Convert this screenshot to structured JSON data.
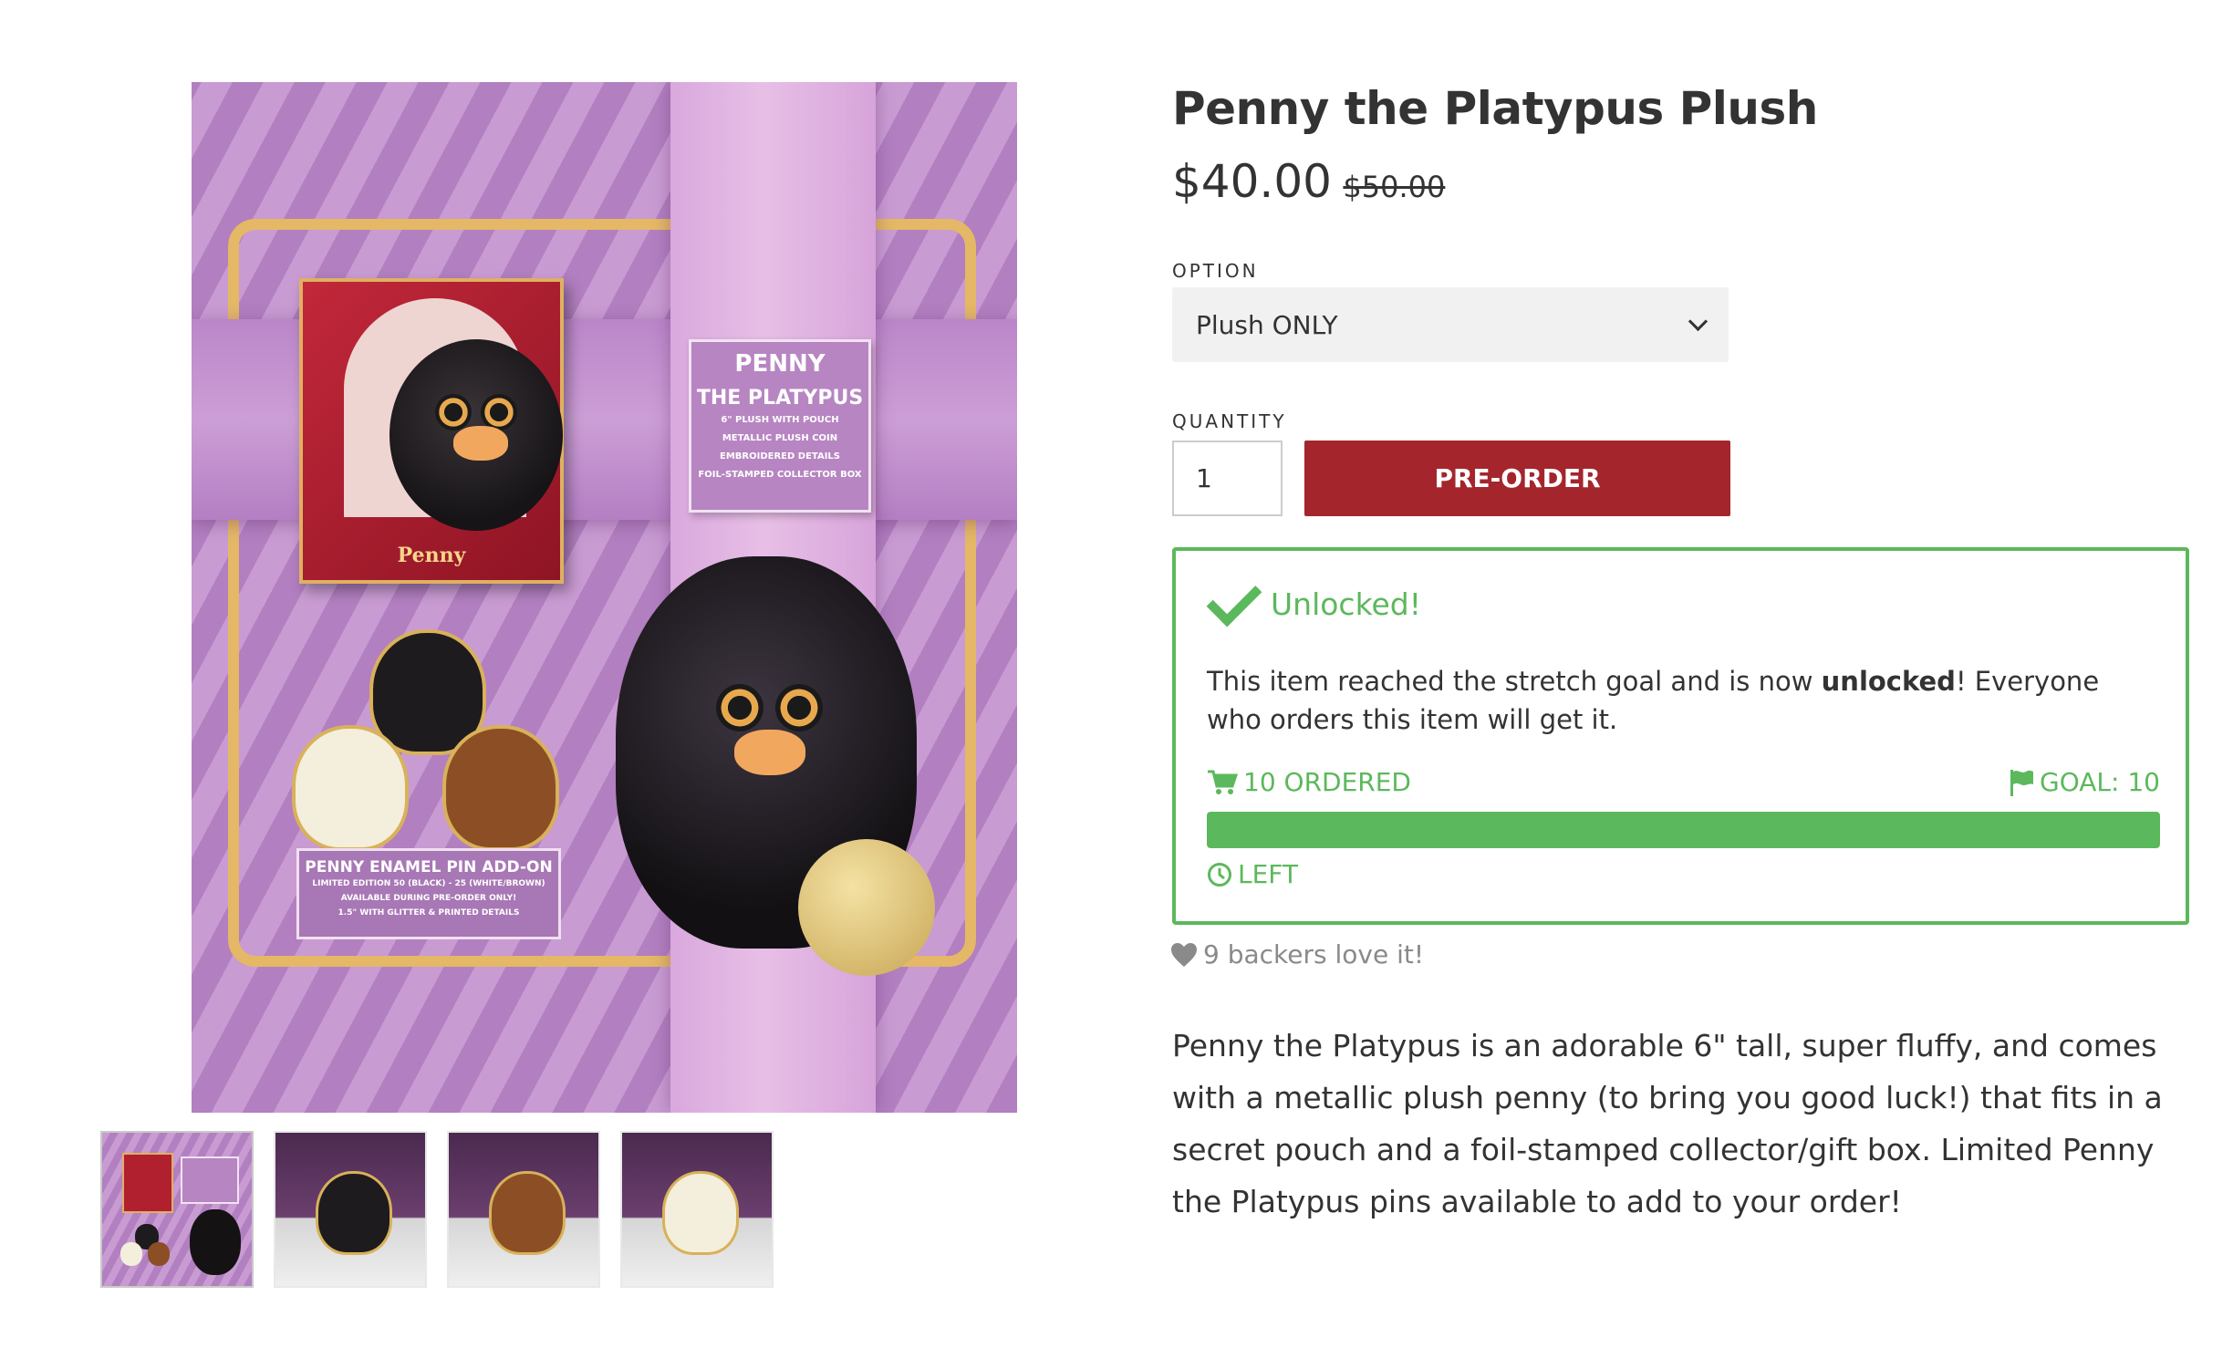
{
  "gallery": {
    "main_alt": "Penny the Platypus Plush product image",
    "box_brand": "Penny",
    "label_card": {
      "title_1": "PENNY",
      "title_2": "THE PLATYPUS",
      "lines": [
        "6\" PLUSH WITH POUCH",
        "METALLIC PLUSH COIN",
        "EMBROIDERED DETAILS",
        "FOIL-STAMPED COLLECTOR BOX"
      ]
    },
    "pin_card": {
      "title": "PENNY ENAMEL PIN ADD-ON",
      "line_1": "LIMITED EDITION 50 (BLACK) - 25 (WHITE/BROWN)",
      "line_2": "AVAILABLE DURING PRE-ORDER ONLY!",
      "line_3": "1.5\" WITH GLITTER & PRINTED DETAILS"
    },
    "thumbnails": [
      {
        "name": "thumb-main",
        "active": true
      },
      {
        "name": "thumb-black-pin"
      },
      {
        "name": "thumb-brown-pin"
      },
      {
        "name": "thumb-white-pin"
      }
    ]
  },
  "product": {
    "title": "Penny the Platypus Plush",
    "price": "$40.00",
    "compare_price": "$50.00",
    "option_label": "OPTION",
    "option_selected": "Plush ONLY",
    "quantity_label": "QUANTITY",
    "quantity_value": "1",
    "preorder_label": "PRE-ORDER"
  },
  "goal": {
    "status": "Unlocked!",
    "desc_before": "This item reached the stretch goal and is now ",
    "desc_bold": "unlocked",
    "desc_after": "! Everyone who orders this item will get it.",
    "ordered": "10 ORDERED",
    "goal_text": "GOAL: 10",
    "progress_fraction": 1.0,
    "left_text": "LEFT",
    "accent_color": "#5cb85c"
  },
  "backers": "9 backers love it!",
  "description": "Penny the Platypus is an adorable 6\" tall, super fluffy, and comes with a metallic plush penny (to bring you good luck!) that fits in a secret pouch and a foil-stamped collector/gift box. Limited Penny the Platypus pins available to add to your order!",
  "colors": {
    "preorder_button": "#a4262c",
    "text": "#333333",
    "muted": "#8a8a8a"
  }
}
